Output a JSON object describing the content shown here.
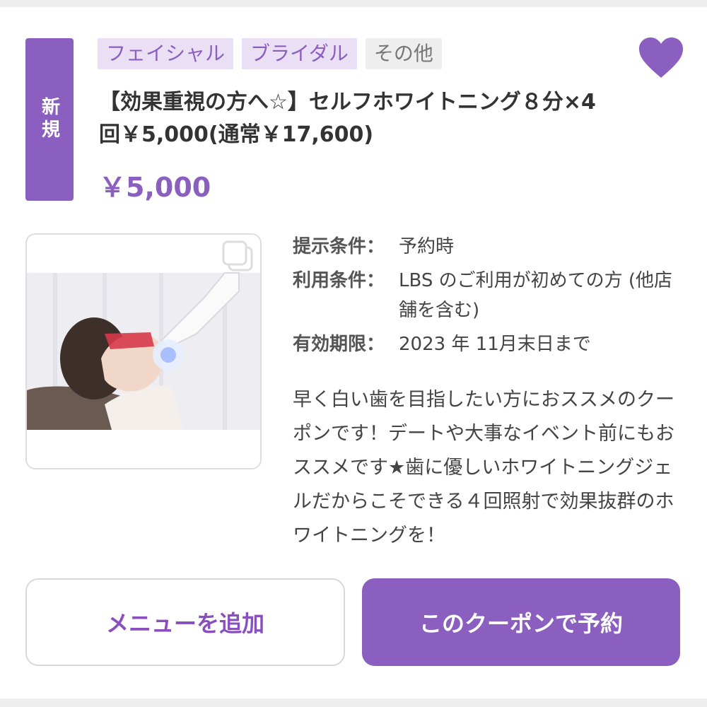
{
  "badge": {
    "label": "新規"
  },
  "tags": [
    {
      "label": "フェイシャル"
    },
    {
      "label": "ブライダル"
    },
    {
      "label": "その他"
    }
  ],
  "favorite": {
    "icon": "heart-icon",
    "color": "#8a5fbf"
  },
  "coupon": {
    "title": "【効果重視の方へ☆】セルフホワイトニング８分×4 回￥5,000(通常￥17,600)",
    "price": "￥5,000"
  },
  "photo": {
    "icon": "gallery-icon"
  },
  "conditions": [
    {
      "label": "提示条件：",
      "value": "予約時"
    },
    {
      "label": "利用条件：",
      "value": "LBS のご利用が初めての方 (他店舗を含む)"
    },
    {
      "label": "有効期限：",
      "value": "2023 年 11月末日まで"
    }
  ],
  "description": "早く白い歯を目指したい方におススメのクーポンです！デートや大事なイベント前にもおススメです★歯に優しいホワイトニングジェルだからこそできる４回照射で効果抜群のホワイトニングを！",
  "buttons": {
    "add_menu": "メニューを追加",
    "reserve": "このクーポンで予約"
  },
  "colors": {
    "accent": "#8a5fbf",
    "tag_bg": "#eadff5",
    "gray_tag_bg": "#eeeeee"
  }
}
